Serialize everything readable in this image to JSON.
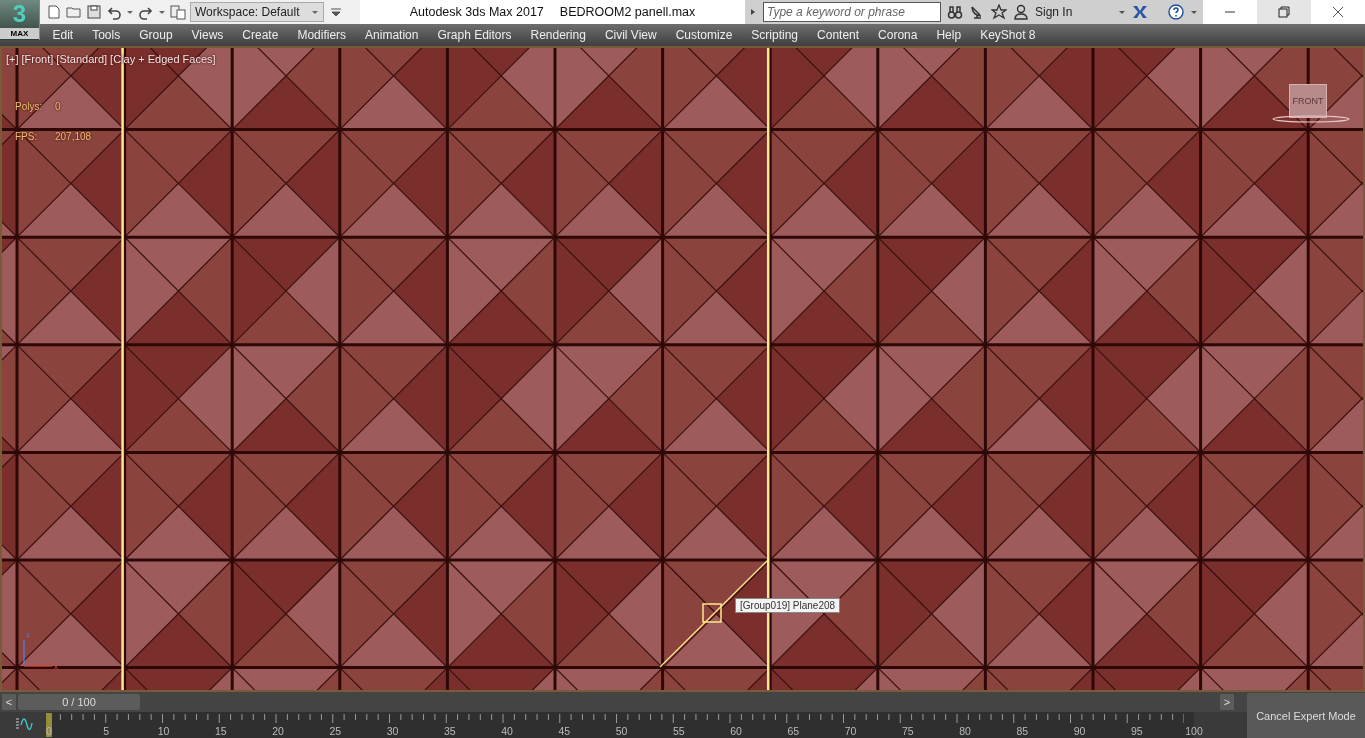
{
  "app": {
    "logo_digit": "3",
    "logo_label": "MAX",
    "workspace": "Workspace: Default",
    "title": "Autodesk 3ds Max 2017",
    "filename": "BEDROOM2 panell.max",
    "search": {
      "placeholder": "Type a keyword or phrase"
    },
    "sign_in": "Sign In"
  },
  "menu": [
    "Edit",
    "Tools",
    "Group",
    "Views",
    "Create",
    "Modifiers",
    "Animation",
    "Graph Editors",
    "Rendering",
    "Civil View",
    "Customize",
    "Scripting",
    "Content",
    "Corona",
    "Help",
    "KeyShot 8"
  ],
  "viewport": {
    "labels": [
      "[+]",
      "[Front]",
      "[Standard]",
      "[Clay + Edged Faces]"
    ],
    "stats": [
      {
        "label": "Polys:",
        "value": "0"
      },
      {
        "label": "FPS:",
        "value": "207,108"
      }
    ],
    "viewcube": "FRONT",
    "tooltip": "[Group019] Plane208",
    "axes": [
      "z",
      "x"
    ]
  },
  "timeline": {
    "prev": "<",
    "frame": "0 / 100",
    "next": ">",
    "level": 0,
    "ticks": [
      "0",
      "5",
      "10",
      "15",
      "20",
      "25",
      "30",
      "35",
      "40",
      "45",
      "50",
      "55",
      "60",
      "65",
      "70",
      "75",
      "80",
      "85",
      "90",
      "95",
      "100"
    ],
    "cancel": "Cancel Expert Mode"
  }
}
